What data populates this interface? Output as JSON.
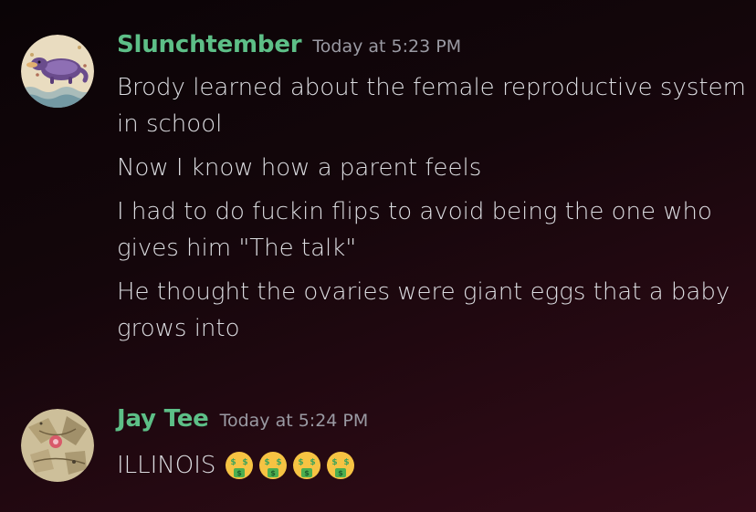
{
  "messages": [
    {
      "username": "Slunchtember",
      "timestamp": "Today at 5:23 PM",
      "avatar_icon": "purple-creature-avatar",
      "name_color": "#5dbf87",
      "lines": [
        "Brody learned about the female reproductive system in school",
        "Now I know how a parent feels",
        "I had to do fuckin flips to avoid being the one who gives him \"The talk\"",
        "He thought the ovaries were giant eggs that a baby grows into"
      ]
    },
    {
      "username": "Jay Tee",
      "timestamp": "Today at 5:24 PM",
      "avatar_icon": "map-pattern-avatar",
      "name_color": "#5dbf87",
      "text": "ILLINOIS",
      "emojis": [
        "money-mouth-face-icon",
        "money-mouth-face-icon",
        "money-mouth-face-icon",
        "money-mouth-face-icon"
      ]
    }
  ]
}
